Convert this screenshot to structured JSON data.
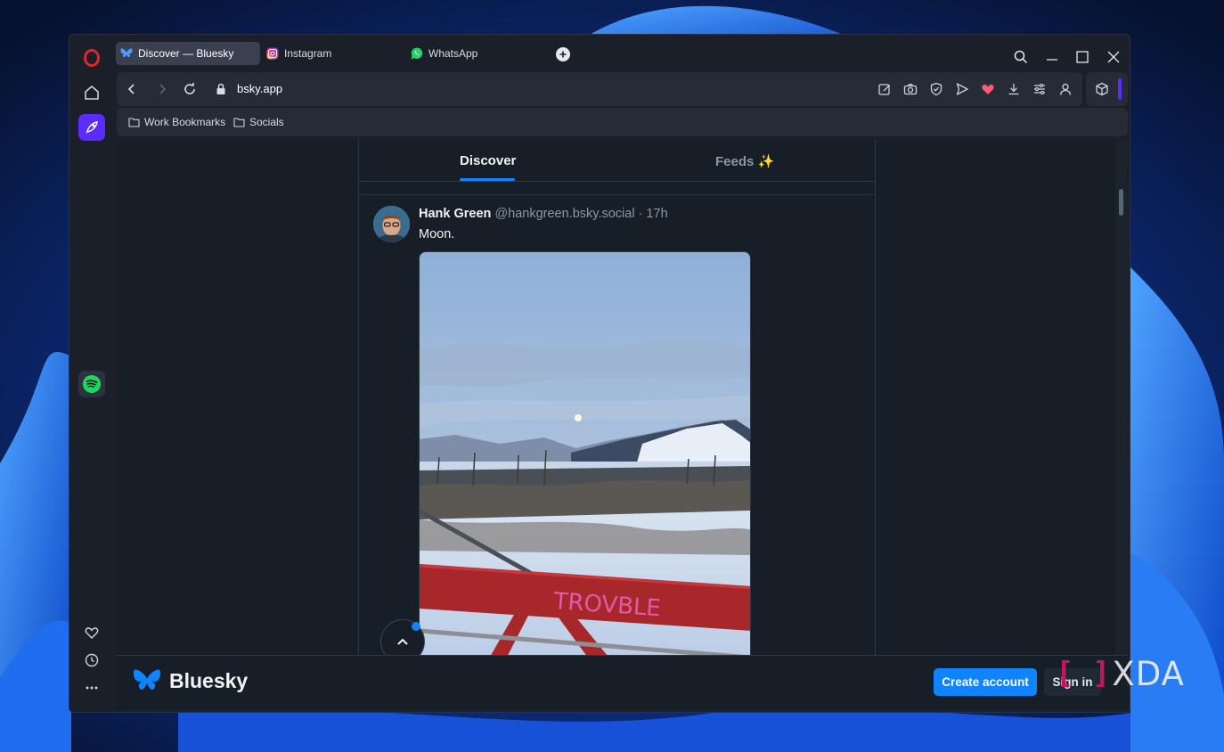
{
  "browser": {
    "tabs": [
      {
        "label": "Discover — Bluesky",
        "active": true,
        "icon": "bluesky-icon"
      },
      {
        "label": "Instagram",
        "active": false,
        "icon": "instagram-icon"
      },
      {
        "label": "WhatsApp",
        "active": false,
        "icon": "whatsapp-icon"
      }
    ],
    "url": "bsky.app",
    "bookmarks": [
      {
        "label": "Work Bookmarks",
        "icon": "folder-icon"
      },
      {
        "label": "Socials",
        "icon": "folder-icon"
      }
    ],
    "accent": "#5b2bff"
  },
  "page": {
    "feed_tabs": [
      {
        "label": "Discover",
        "active": true
      },
      {
        "label": "Feeds ✨",
        "active": false
      }
    ],
    "post": {
      "author": "Hank Green",
      "meta": "@hankgreen.bsky.social · 17h",
      "text": "Moon.",
      "image_graffiti": "TROVBLE"
    },
    "brand": "Bluesky",
    "create_account": "Create account",
    "sign_in": "Sign in",
    "accent": "#1083fe"
  },
  "watermark": {
    "text": "XDA",
    "bracket": "[ ]"
  }
}
